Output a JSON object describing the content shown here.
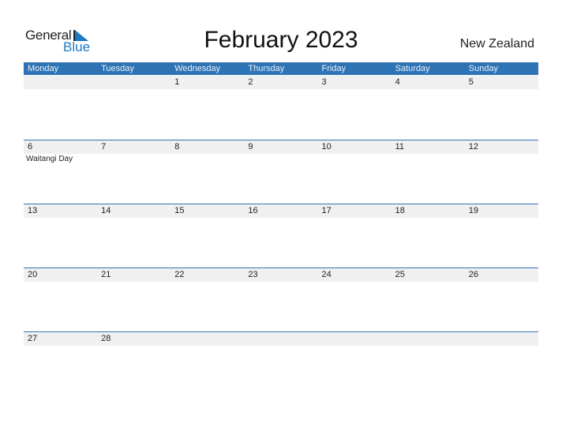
{
  "logo": {
    "general": "General",
    "blue": "Blue"
  },
  "title": "February 2023",
  "country": "New Zealand",
  "weekdays": [
    "Monday",
    "Tuesday",
    "Wednesday",
    "Thursday",
    "Friday",
    "Saturday",
    "Sunday"
  ],
  "weeks": [
    {
      "days": [
        "",
        "",
        "1",
        "2",
        "3",
        "4",
        "5"
      ],
      "events": [
        "",
        "",
        "",
        "",
        "",
        "",
        ""
      ]
    },
    {
      "days": [
        "6",
        "7",
        "8",
        "9",
        "10",
        "11",
        "12"
      ],
      "events": [
        "Waitangi Day",
        "",
        "",
        "",
        "",
        "",
        ""
      ]
    },
    {
      "days": [
        "13",
        "14",
        "15",
        "16",
        "17",
        "18",
        "19"
      ],
      "events": [
        "",
        "",
        "",
        "",
        "",
        "",
        ""
      ]
    },
    {
      "days": [
        "20",
        "21",
        "22",
        "23",
        "24",
        "25",
        "26"
      ],
      "events": [
        "",
        "",
        "",
        "",
        "",
        "",
        ""
      ]
    },
    {
      "days": [
        "27",
        "28",
        "",
        "",
        "",
        "",
        ""
      ],
      "events": [
        "",
        "",
        "",
        "",
        "",
        "",
        ""
      ]
    }
  ],
  "colors": {
    "accent": "#2e74b5",
    "strip": "#f0f0f0",
    "logo_blue": "#1f7ac2"
  }
}
